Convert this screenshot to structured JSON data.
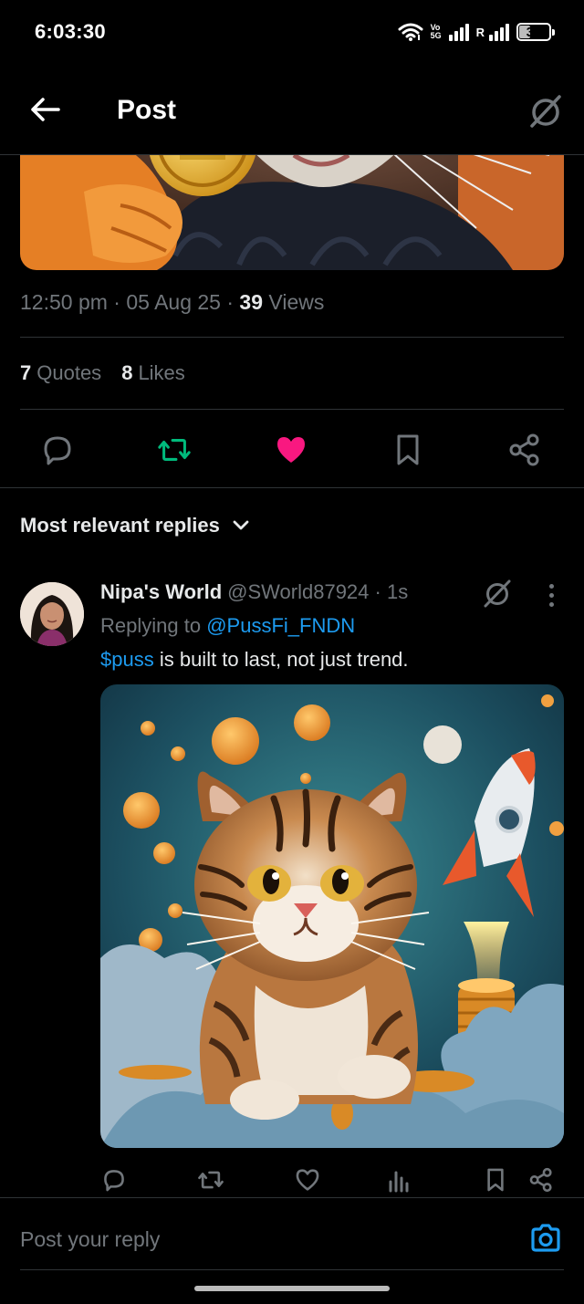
{
  "status_bar": {
    "time": "6:03:30",
    "network_top": "Vo",
    "network_bottom": "5G",
    "second_sim_label": "R",
    "battery": "36",
    "battery_level": 0.36
  },
  "header": {
    "title": "Post"
  },
  "post": {
    "time": "12:50 pm",
    "date": "05 Aug 25",
    "views_count": "39",
    "views_label": "Views",
    "quotes_count": "7",
    "quotes_label": "Quotes",
    "likes_count": "8",
    "likes_label": "Likes",
    "liked": true,
    "reposted": true
  },
  "replies": {
    "sort_label": "Most relevant replies",
    "items": [
      {
        "name": "Nipa's World",
        "handle": "@SWorld87924",
        "time": "1s",
        "replying_label": "Replying to",
        "replying_to": "@PussFi_FNDN",
        "cashtag": "$puss",
        "text": " is built to last, not just trend."
      }
    ]
  },
  "composer": {
    "placeholder": "Post your reply"
  },
  "colors": {
    "background": "#000000",
    "accent_blue": "#1d9bf0",
    "repost_green": "#00ba7c",
    "like_pink": "#f91880",
    "muted": "#71767b",
    "divider": "#2f3336"
  },
  "icons": [
    "back-arrow-icon",
    "grok-icon",
    "reply-icon",
    "repost-icon",
    "heart-icon",
    "bookmark-icon",
    "share-icon",
    "chevron-down-icon",
    "more-icon",
    "views-icon",
    "camera-icon"
  ]
}
